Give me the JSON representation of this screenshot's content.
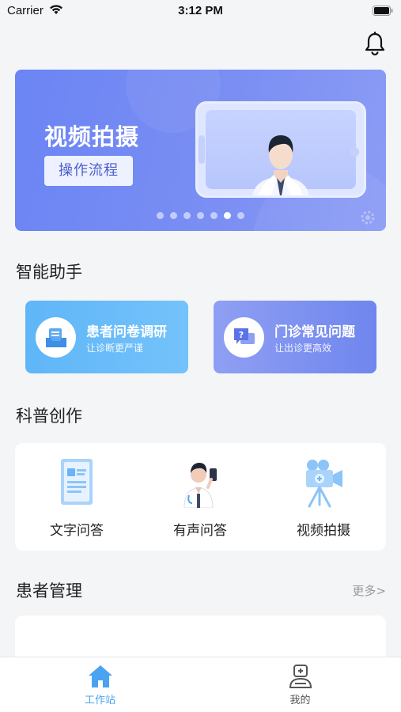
{
  "status_bar": {
    "carrier": "Carrier",
    "time": "3:12 PM"
  },
  "banner": {
    "title": "视频拍摄",
    "button": "操作流程",
    "page_count": 7,
    "active_page": 6
  },
  "sections": {
    "assistant": "智能助手",
    "creation": "科普创作",
    "patients": "患者管理",
    "patients_more": "更多>"
  },
  "assistant_cards": [
    {
      "title": "患者问卷调研",
      "subtitle": "让诊断更严谨",
      "icon": "document-tray-icon"
    },
    {
      "title": "门诊常见问题",
      "subtitle": "让出诊更高效",
      "icon": "question-chat-icon"
    }
  ],
  "creation_items": [
    {
      "label": "文字问答",
      "icon": "text-document-icon"
    },
    {
      "label": "有声问答",
      "icon": "doctor-phone-icon"
    },
    {
      "label": "视频拍摄",
      "icon": "video-camera-icon"
    }
  ],
  "tabs": [
    {
      "label": "工作站",
      "icon": "home-icon",
      "active": true
    },
    {
      "label": "我的",
      "icon": "doctor-profile-icon",
      "active": false
    }
  ],
  "colors": {
    "banner": "#6b85f4",
    "survey_card": "#5fb6f7",
    "faq_card": "#7f93f1",
    "tab_active": "#4aa3f0",
    "background": "#f4f5f7"
  }
}
